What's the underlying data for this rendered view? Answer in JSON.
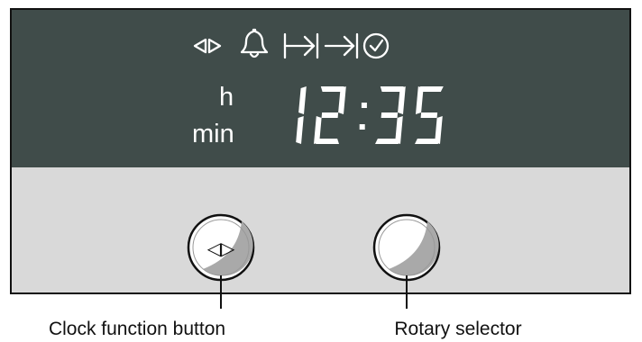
{
  "display": {
    "units": {
      "hours": "h",
      "minutes": "min"
    },
    "time": "12:35",
    "icons": [
      "clock-function-icon",
      "bell-icon",
      "cooking-time-icon",
      "end-time-icon",
      "clock-icon"
    ]
  },
  "controls": {
    "clock_button_symbol": "◁▷"
  },
  "labels": {
    "clock_function_button": "Clock function button",
    "rotary_selector": "Rotary selector"
  },
  "colors": {
    "display_bg": "#404c4a",
    "panel_bg": "#d9d9d9",
    "foreground": "#ffffff",
    "knob_shade": "#a9a9a9"
  }
}
